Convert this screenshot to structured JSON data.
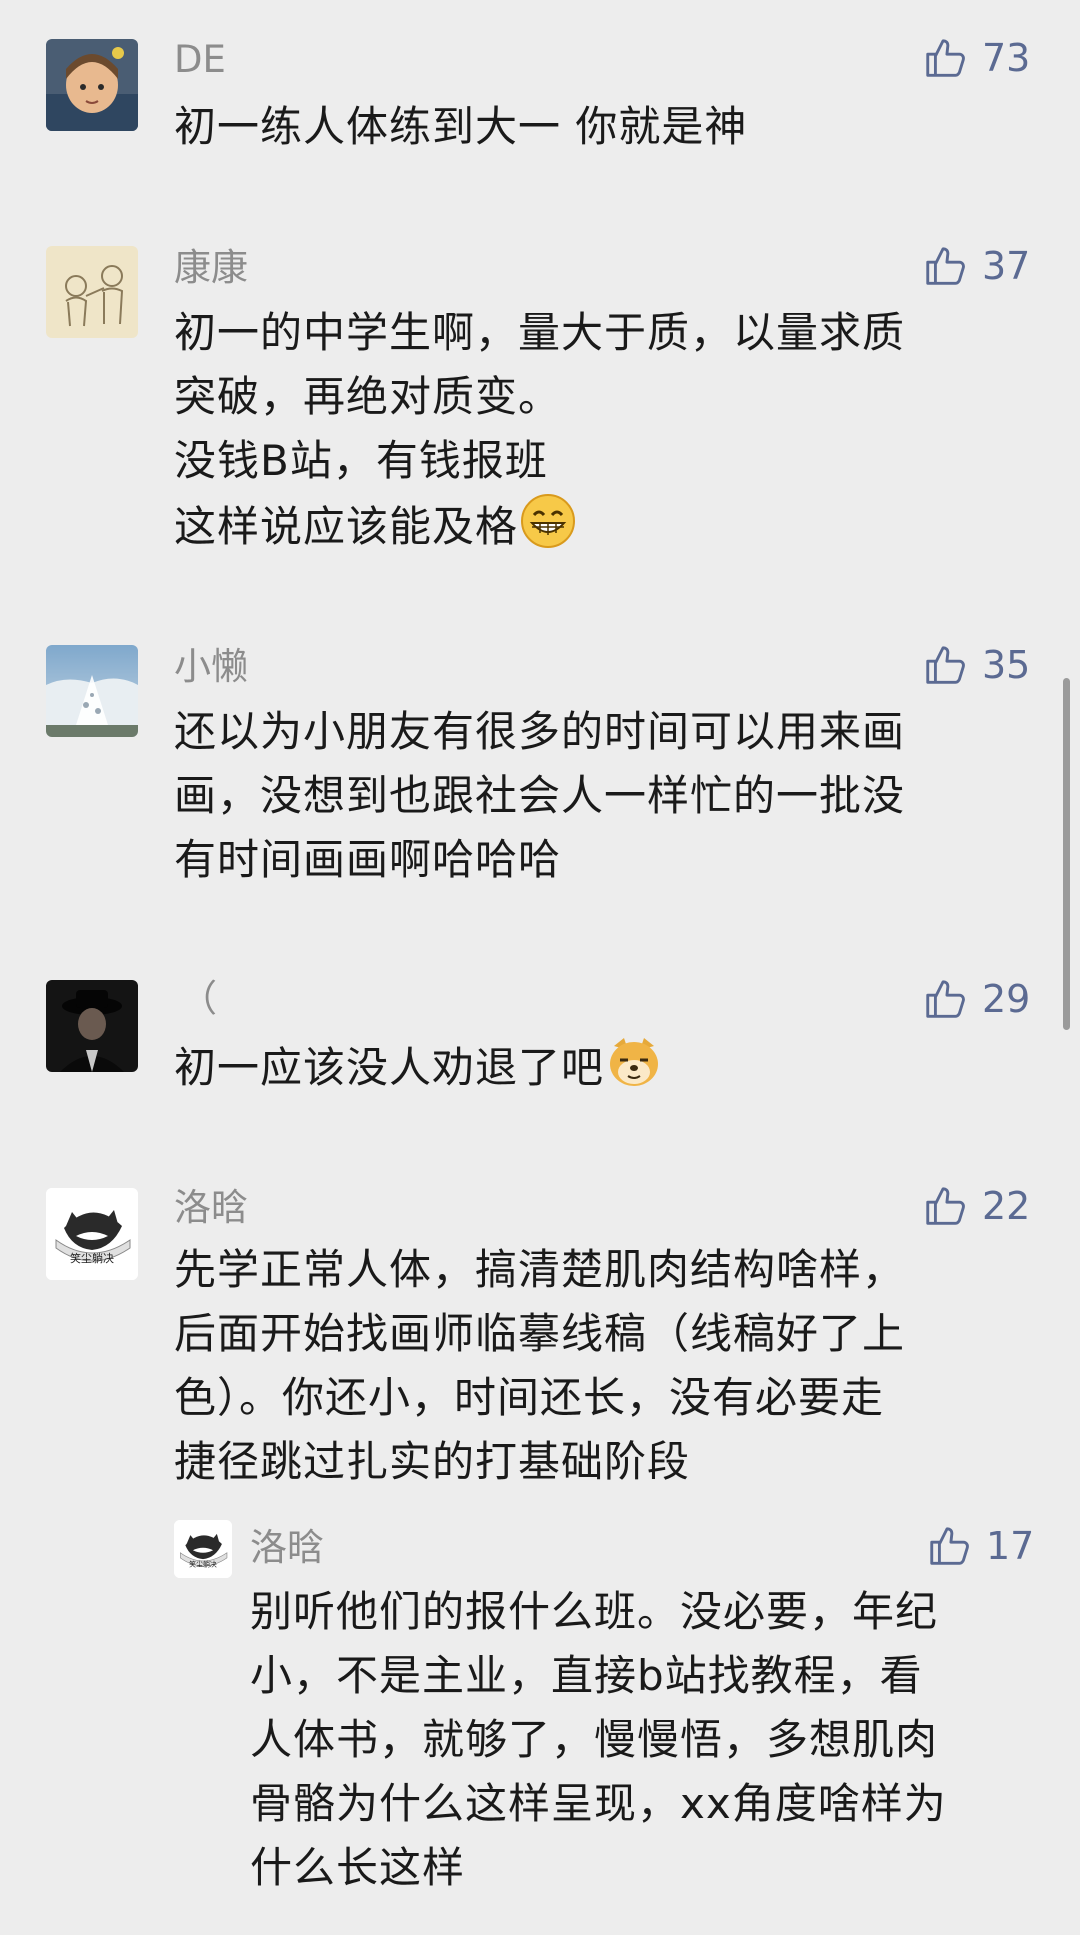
{
  "comments": [
    {
      "name": "DE",
      "likes": "73",
      "avatar_icon": "avatar-girl-cartoon",
      "lines": [
        "初一练人体练到大一 你就是神"
      ]
    },
    {
      "name": "康康",
      "likes": "37",
      "avatar_icon": "avatar-sketch",
      "lines": [
        "初一的中学生啊，量大于质，以量求质",
        "突破，再绝对质变。",
        "没钱B站，有钱报班",
        "这样说应该能及格"
      ],
      "emoji": "grinning-emoji"
    },
    {
      "name": "小懒",
      "likes": "35",
      "avatar_icon": "avatar-snow-tree",
      "lines": [
        "还以为小朋友有很多的时间可以用来画",
        "画，没想到也跟社会人一样忙的一批没",
        "有时间画画啊哈哈哈"
      ]
    },
    {
      "name": "（",
      "likes": "29",
      "avatar_icon": "avatar-dark-portrait",
      "lines": [
        "初一应该没人劝退了吧"
      ],
      "emoji": "doge-emoji"
    },
    {
      "name": "洛晗",
      "likes": "22",
      "avatar_icon": "avatar-cat-logo",
      "avatar_text": "笑尘躺决",
      "lines": [
        "先学正常人体，搞清楚肌肉结构啥样，",
        "后面开始找画师临摹线稿（线稿好了上",
        "色）。你还小，时间还长，没有必要走",
        "捷径跳过扎实的打基础阶段"
      ]
    }
  ],
  "reply": {
    "name": "洛晗",
    "likes": "17",
    "avatar_icon": "avatar-cat-logo",
    "avatar_text": "笑尘躺决",
    "lines": [
      "别听他们的报什么班。没必要，年纪",
      "小，不是主业，直接b站找教程，看",
      "人体书，就够了，慢慢悟，多想肌肉",
      "骨骼为什么这样呈现，xx角度啥样为",
      "什么长这样"
    ]
  },
  "colors": {
    "background": "#ededed",
    "name": "#8c8c8c",
    "like": "#5b6a92",
    "text": "#1a1a1a"
  }
}
